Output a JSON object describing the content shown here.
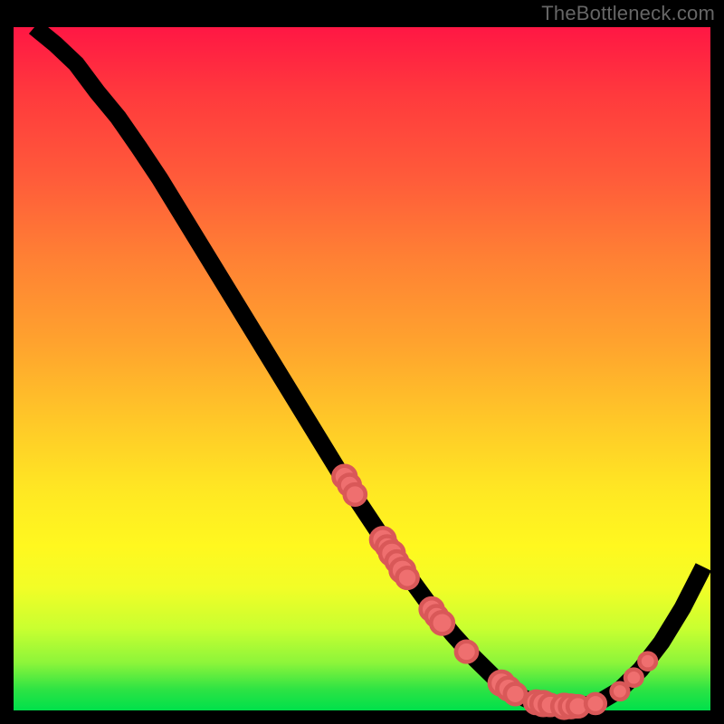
{
  "attribution": "TheBottleneck.com",
  "chart_data": {
    "type": "line",
    "title": "",
    "xlabel": "",
    "ylabel": "",
    "xlim": [
      0,
      100
    ],
    "ylim": [
      0,
      100
    ],
    "background_gradient": {
      "top": "#ff1744",
      "mid": "#ffe823",
      "bottom": "#00e04b"
    },
    "curve": [
      {
        "x": 3.0,
        "y": 100.0
      },
      {
        "x": 6.0,
        "y": 97.5
      },
      {
        "x": 9.0,
        "y": 94.6
      },
      {
        "x": 12.0,
        "y": 90.5
      },
      {
        "x": 15.0,
        "y": 86.8
      },
      {
        "x": 18.0,
        "y": 82.4
      },
      {
        "x": 21.0,
        "y": 77.8
      },
      {
        "x": 24.0,
        "y": 72.8
      },
      {
        "x": 27.0,
        "y": 67.8
      },
      {
        "x": 30.0,
        "y": 62.8
      },
      {
        "x": 33.0,
        "y": 57.8
      },
      {
        "x": 36.0,
        "y": 52.8
      },
      {
        "x": 39.0,
        "y": 47.8
      },
      {
        "x": 42.0,
        "y": 42.8
      },
      {
        "x": 45.0,
        "y": 37.8
      },
      {
        "x": 48.0,
        "y": 32.8
      },
      {
        "x": 51.0,
        "y": 28.2
      },
      {
        "x": 54.0,
        "y": 23.6
      },
      {
        "x": 57.0,
        "y": 19.2
      },
      {
        "x": 60.0,
        "y": 15.0
      },
      {
        "x": 63.0,
        "y": 11.2
      },
      {
        "x": 66.0,
        "y": 7.8
      },
      {
        "x": 69.0,
        "y": 4.8
      },
      {
        "x": 72.0,
        "y": 2.4
      },
      {
        "x": 75.0,
        "y": 1.0
      },
      {
        "x": 78.0,
        "y": 0.6
      },
      {
        "x": 81.0,
        "y": 0.6
      },
      {
        "x": 84.0,
        "y": 1.2
      },
      {
        "x": 87.0,
        "y": 3.0
      },
      {
        "x": 90.0,
        "y": 6.0
      },
      {
        "x": 93.0,
        "y": 10.0
      },
      {
        "x": 96.0,
        "y": 15.0
      },
      {
        "x": 99.0,
        "y": 21.0
      }
    ],
    "markers": [
      {
        "x": 47.5,
        "y": 34.2,
        "r": 1.6
      },
      {
        "x": 48.2,
        "y": 33.0,
        "r": 1.5
      },
      {
        "x": 49.0,
        "y": 31.6,
        "r": 1.5
      },
      {
        "x": 53.0,
        "y": 25.0,
        "r": 1.7
      },
      {
        "x": 53.6,
        "y": 24.0,
        "r": 1.5
      },
      {
        "x": 54.3,
        "y": 23.0,
        "r": 1.7
      },
      {
        "x": 55.0,
        "y": 21.8,
        "r": 1.5
      },
      {
        "x": 55.8,
        "y": 20.5,
        "r": 1.7
      },
      {
        "x": 56.5,
        "y": 19.4,
        "r": 1.5
      },
      {
        "x": 60.0,
        "y": 14.8,
        "r": 1.6
      },
      {
        "x": 60.7,
        "y": 13.8,
        "r": 1.5
      },
      {
        "x": 61.5,
        "y": 12.8,
        "r": 1.6
      },
      {
        "x": 65.0,
        "y": 8.6,
        "r": 1.5
      },
      {
        "x": 70.0,
        "y": 4.0,
        "r": 1.7
      },
      {
        "x": 71.0,
        "y": 3.2,
        "r": 1.6
      },
      {
        "x": 72.0,
        "y": 2.4,
        "r": 1.5
      },
      {
        "x": 75.0,
        "y": 1.2,
        "r": 1.6
      },
      {
        "x": 76.0,
        "y": 1.0,
        "r": 1.7
      },
      {
        "x": 77.0,
        "y": 0.8,
        "r": 1.5
      },
      {
        "x": 79.0,
        "y": 0.6,
        "r": 1.7
      },
      {
        "x": 80.0,
        "y": 0.6,
        "r": 1.6
      },
      {
        "x": 81.0,
        "y": 0.6,
        "r": 1.5
      },
      {
        "x": 83.5,
        "y": 1.0,
        "r": 1.4
      },
      {
        "x": 87.0,
        "y": 2.8,
        "r": 1.2
      },
      {
        "x": 89.0,
        "y": 4.8,
        "r": 1.2
      },
      {
        "x": 91.0,
        "y": 7.2,
        "r": 1.2
      }
    ]
  }
}
